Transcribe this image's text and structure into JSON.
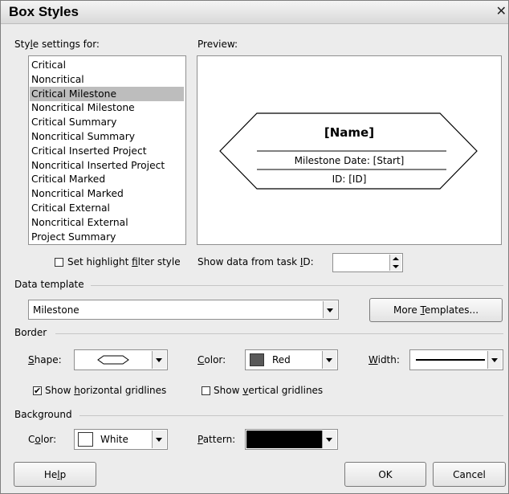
{
  "window": {
    "title": "Box Styles",
    "close_glyph": "✕"
  },
  "style_settings": {
    "label": "Style settings for:",
    "items": [
      "Critical",
      "Noncritical",
      "Critical Milestone",
      "Noncritical Milestone",
      "Critical Summary",
      "Noncritical Summary",
      "Critical Inserted Project",
      "Noncritical Inserted Project",
      "Critical Marked",
      "Noncritical Marked",
      "Critical External",
      "Noncritical External",
      "Project Summary"
    ],
    "selected": "Critical Milestone"
  },
  "preview": {
    "label": "Preview:",
    "name_field": "[Name]",
    "row1": "Milestone Date: [Start]",
    "row2": "ID: [ID]"
  },
  "highlight": {
    "label": "Set highlight filter style",
    "checked": false
  },
  "show_data": {
    "label": "Show data from task ID:",
    "value": ""
  },
  "data_template": {
    "section_label": "Data template",
    "selected": "Milestone",
    "more_button": "More Templates..."
  },
  "border": {
    "section_label": "Border",
    "shape_label": "Shape:",
    "shape_icon": "hexagon-icon",
    "color_label": "Color:",
    "color_value": "Red",
    "color_swatch": "#595959",
    "width_label": "Width:",
    "horizontal_gridlines": {
      "label": "Show horizontal gridlines",
      "checked": true
    },
    "vertical_gridlines": {
      "label": "Show vertical gridlines",
      "checked": false
    }
  },
  "background": {
    "section_label": "Background",
    "color_label": "Color:",
    "color_value": "White",
    "color_swatch": "#ffffff",
    "pattern_label": "Pattern:",
    "pattern_swatch": "#000000"
  },
  "buttons": {
    "help": "Help",
    "ok": "OK",
    "cancel": "Cancel"
  }
}
